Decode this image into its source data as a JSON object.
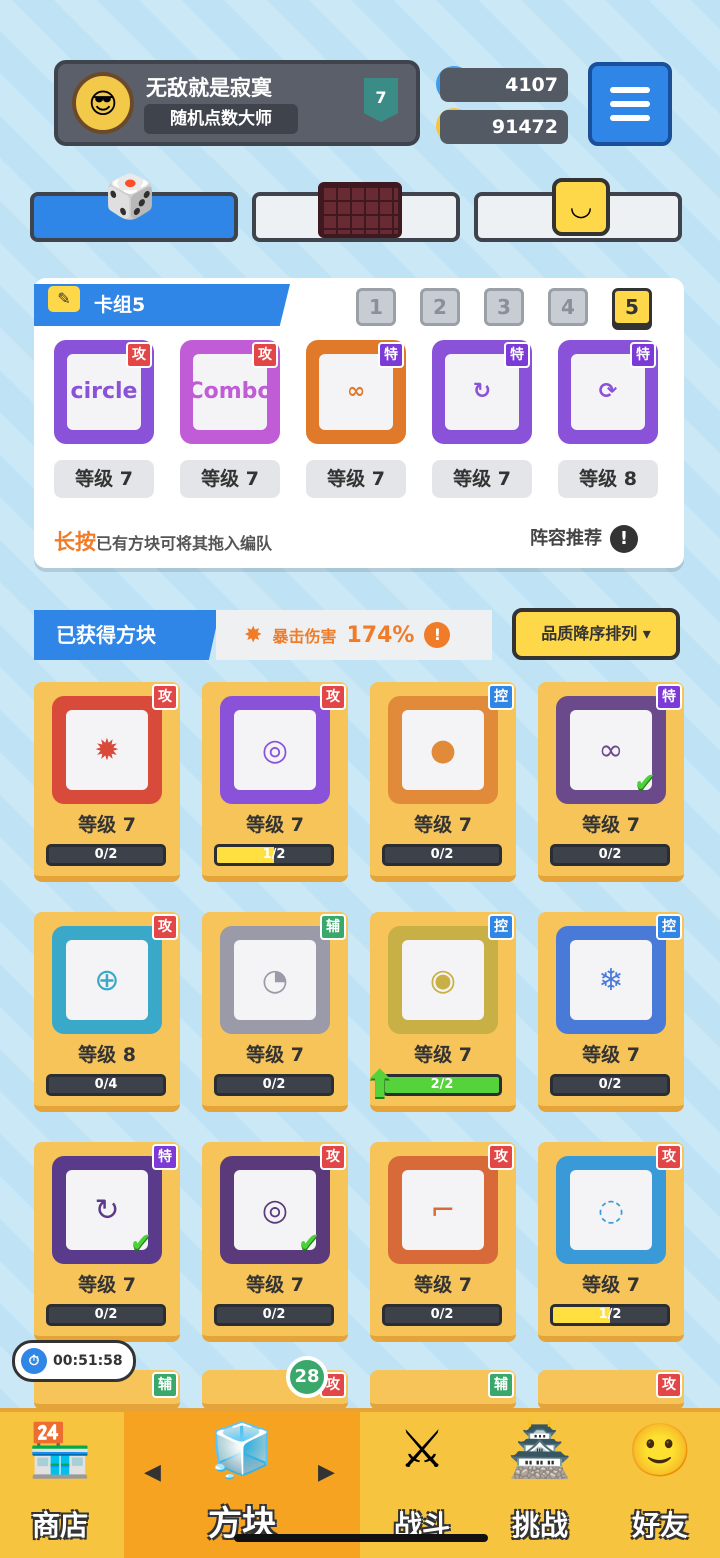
{
  "profile": {
    "name": "无敌就是寂寞",
    "title": "随机点数大师",
    "rank": "7"
  },
  "resources": {
    "gems": "4107",
    "coins": "91472"
  },
  "colors": {
    "accent": "#2f86e6",
    "attack": "#e24646",
    "special": "#7c3bd6",
    "control": "#2f86e6",
    "support": "#3aa86b"
  },
  "deck": {
    "label": "卡组5",
    "numbers": [
      "1",
      "2",
      "3",
      "4",
      "5"
    ],
    "selected": "5",
    "cards": [
      {
        "type": "攻",
        "level": "等级 7",
        "frame": "#8a52d8",
        "icon": "circle"
      },
      {
        "type": "攻",
        "level": "等级 7",
        "frame": "#c05cd6",
        "icon": "Combo"
      },
      {
        "type": "特",
        "level": "等级 7",
        "frame": "#e07a2a",
        "icon": "∞"
      },
      {
        "type": "特",
        "level": "等级 7",
        "frame": "#8a52d8",
        "icon": "↻"
      },
      {
        "type": "特",
        "level": "等级 8",
        "frame": "#8a52d8",
        "icon": "⟳"
      }
    ],
    "hint_highlight": "长按",
    "hint_text": "已有方块可将其拖入编队",
    "recommend": "阵容推荐"
  },
  "owned": {
    "label": "已获得方块",
    "crit_label": "暴击伤害",
    "crit_value": "174%",
    "sort": "品质降序排列"
  },
  "grid": [
    {
      "type": "攻",
      "level": "等级 7",
      "progress": "0/2",
      "fill": 0,
      "frame": "#d84a3a",
      "icon": "✹",
      "check": false,
      "up": false
    },
    {
      "type": "攻",
      "level": "等级 7",
      "progress": "1/2",
      "fill": 0.5,
      "frame": "#8a52d8",
      "icon": "◎",
      "check": false,
      "up": false
    },
    {
      "type": "控",
      "level": "等级 7",
      "progress": "0/2",
      "fill": 0,
      "frame": "#e08a3a",
      "icon": "●",
      "check": false,
      "up": false
    },
    {
      "type": "特",
      "level": "等级 7",
      "progress": "0/2",
      "fill": 0,
      "frame": "#6a4a8a",
      "icon": "∞",
      "check": true,
      "up": false
    },
    {
      "type": "攻",
      "level": "等级 8",
      "progress": "0/4",
      "fill": 0,
      "frame": "#3aa8c8",
      "icon": "⊕",
      "check": false,
      "up": false
    },
    {
      "type": "辅",
      "level": "等级 7",
      "progress": "0/2",
      "fill": 0,
      "frame": "#9a9aa8",
      "icon": "◔",
      "check": false,
      "up": false
    },
    {
      "type": "控",
      "level": "等级 7",
      "progress": "2/2",
      "fill": 1,
      "frame": "#c8b046",
      "icon": "◉",
      "check": false,
      "up": true
    },
    {
      "type": "控",
      "level": "等级 7",
      "progress": "0/2",
      "fill": 0,
      "frame": "#4a7ad8",
      "icon": "❄",
      "check": false,
      "up": false
    },
    {
      "type": "特",
      "level": "等级 7",
      "progress": "0/2",
      "fill": 0,
      "frame": "#5a3a8a",
      "icon": "↻",
      "check": true,
      "up": false
    },
    {
      "type": "攻",
      "level": "等级 7",
      "progress": "0/2",
      "fill": 0,
      "frame": "#5a3a7a",
      "icon": "◎",
      "check": true,
      "up": false
    },
    {
      "type": "攻",
      "level": "等级 7",
      "progress": "0/2",
      "fill": 0,
      "frame": "#d86a3a",
      "icon": "⌐",
      "check": false,
      "up": false
    },
    {
      "type": "攻",
      "level": "等级 7",
      "progress": "1/2",
      "fill": 0.5,
      "frame": "#3a9ad8",
      "icon": "◌",
      "check": false,
      "up": false
    }
  ],
  "timer": "00:51:58",
  "nav": {
    "shop": "商店",
    "blocks": "方块",
    "battle": "战斗",
    "challenge": "挑战",
    "friends": "好友",
    "badge": "28"
  }
}
